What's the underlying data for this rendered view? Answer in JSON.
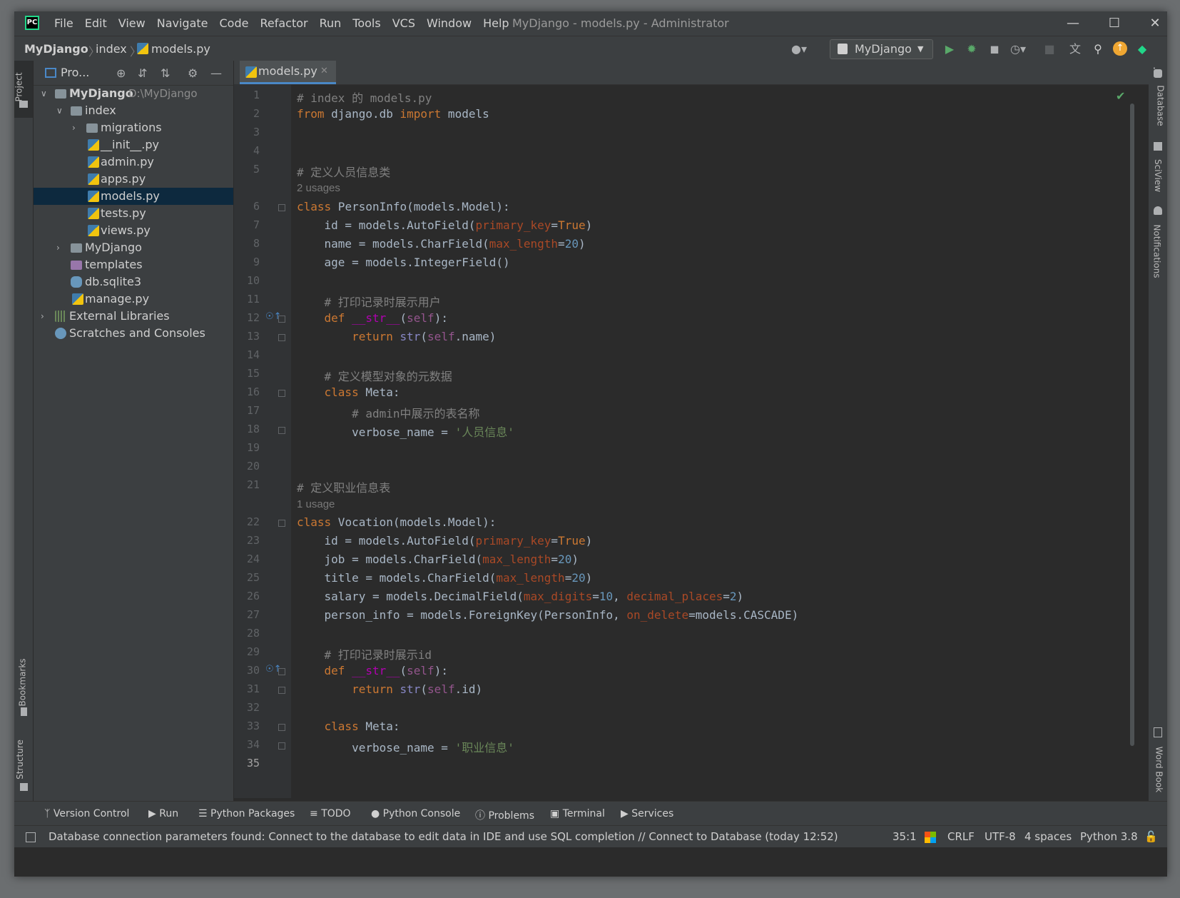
{
  "window": {
    "title": "MyDjango - models.py - Administrator",
    "menu": [
      "File",
      "Edit",
      "View",
      "Navigate",
      "Code",
      "Refactor",
      "Run",
      "Tools",
      "VCS",
      "Window",
      "Help"
    ]
  },
  "breadcrumb": [
    "MyDjango",
    "index",
    "models.py"
  ],
  "toolbar": {
    "run_config": "MyDjango"
  },
  "left_strip": {
    "project": "Project",
    "bookmarks": "Bookmarks",
    "structure": "Structure"
  },
  "right_strip": {
    "database": "Database",
    "sciview": "SciView",
    "notifications": "Notifications",
    "wordbook": "Word Book"
  },
  "project_panel": {
    "title": "Pro...",
    "tree": [
      {
        "label": "MyDjango",
        "path": "D:\\MyDjango",
        "bold": true
      },
      {
        "label": "index"
      },
      {
        "label": "migrations"
      },
      {
        "label": "__init__.py"
      },
      {
        "label": "admin.py"
      },
      {
        "label": "apps.py"
      },
      {
        "label": "models.py"
      },
      {
        "label": "tests.py"
      },
      {
        "label": "views.py"
      },
      {
        "label": "MyDjango"
      },
      {
        "label": "templates"
      },
      {
        "label": "db.sqlite3"
      },
      {
        "label": "manage.py"
      },
      {
        "label": "External Libraries"
      },
      {
        "label": "Scratches and Consoles"
      }
    ]
  },
  "editor": {
    "tab": "models.py",
    "usages_1": "2 usages",
    "usages_2": "1 usage",
    "cursor_line": 35
  },
  "tool_windows": [
    "Version Control",
    "Run",
    "Python Packages",
    "TODO",
    "Python Console",
    "Problems",
    "Terminal",
    "Services"
  ],
  "status": {
    "message": "Database connection parameters found: Connect to the database to edit data in IDE and use SQL completion // Connect to Database (today 12:52)",
    "position": "35:1",
    "line_sep": "CRLF",
    "encoding": "UTF-8",
    "indent": "4 spaces",
    "interpreter": "Python 3.8"
  },
  "colors": {
    "accent": "#4a88c7",
    "bg": "#2b2b2b",
    "panel": "#3c3f41",
    "selection": "#0d293e"
  }
}
